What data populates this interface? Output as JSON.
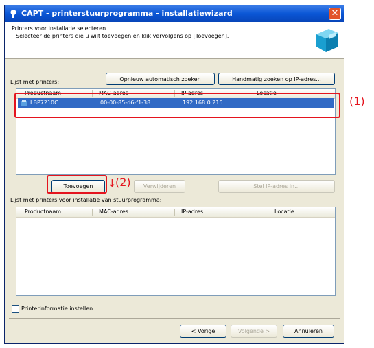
{
  "window": {
    "title": "CAPT - printerstuurprogramma - installatiewizard",
    "close_glyph": "✕"
  },
  "header": {
    "title": "Printers voor installatie selecteren",
    "description": "Selecteer de printers die u wilt toevoegen en klik vervolgens op [Toevoegen]."
  },
  "printers_list": {
    "label": "Lijst met printers:",
    "auto_search_button": "Opnieuw automatisch zoeken",
    "manual_search_button": "Handmatig zoeken op IP-adres...",
    "columns": [
      "Productnaam",
      "MAC-adres",
      "IP-adres",
      "Locatie"
    ],
    "rows": [
      {
        "product": "LBP7210C",
        "mac": "00-00-85-d6-f1-38",
        "ip": "192.168.0.215",
        "location": ""
      }
    ]
  },
  "actions": {
    "add_button": "Toevoegen",
    "remove_button": "Verwijderen",
    "set_ip_button": "Stel IP-adres in..."
  },
  "install_list": {
    "label": "Lijst met printers voor installatie van stuurprogramma:",
    "columns": [
      "Productnaam",
      "MAC-adres",
      "IP-adres",
      "Locatie"
    ]
  },
  "checkbox": {
    "label": "Printerinformatie instellen",
    "checked": false
  },
  "nav": {
    "back": "< Vorige",
    "next": "Volgende >",
    "cancel": "Annuleren"
  },
  "callouts": {
    "one": "(1)",
    "two": "(2)",
    "arrow": "↓"
  },
  "colors": {
    "highlight": "#e4141e",
    "selection": "#316ac5",
    "titlebar": "#0a56d6"
  }
}
